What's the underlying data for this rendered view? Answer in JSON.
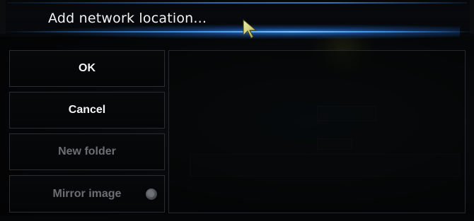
{
  "dialog": {
    "title": "Add network location..."
  },
  "buttons": {
    "ok": "OK",
    "cancel": "Cancel",
    "new_folder": "New folder",
    "mirror_image": "Mirror image"
  },
  "icons": {
    "cursor": "mouse-pointer-icon",
    "mirror_toggle": "radio-toggle-icon"
  },
  "colors": {
    "accent": "#3b8fe0",
    "background": "#030405",
    "enabled_text": "#f4f4f4",
    "disabled_text": "#6b6e72",
    "border": "#2a2e33",
    "cursor_fill": "#d7d77a"
  }
}
